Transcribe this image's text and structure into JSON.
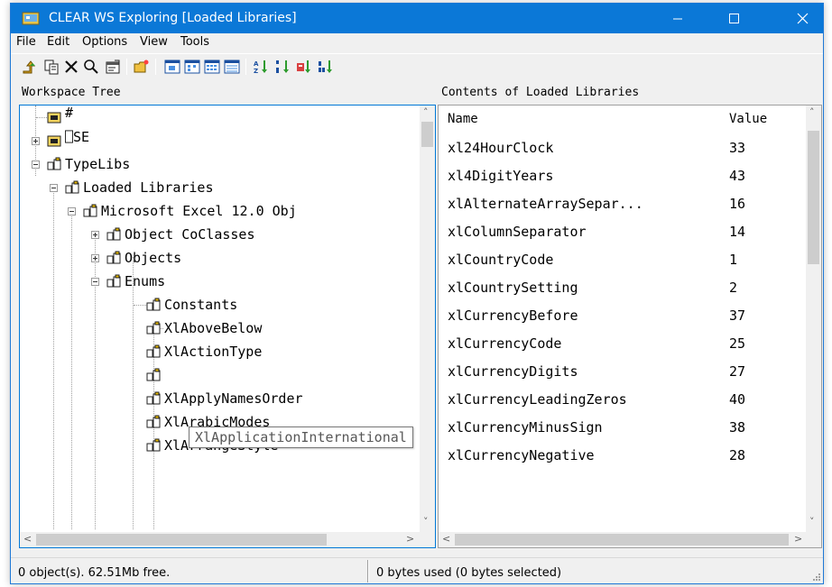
{
  "window": {
    "title": "CLEAR WS Exploring [Loaded Libraries]"
  },
  "menu": [
    "File",
    "Edit",
    "Options",
    "View",
    "Tools"
  ],
  "toolbar": {
    "buttons": [
      "up-folder-icon",
      "copy-icon",
      "delete-icon",
      "find-icon",
      "properties-icon",
      "new-folder-icon",
      "large-icons-view-icon",
      "small-icons-view-icon",
      "list-view-icon",
      "details-view-icon",
      "sort-by-name-icon",
      "sort-by-type-icon",
      "sort-by-size-icon",
      "sort-by-date-icon"
    ]
  },
  "tree": {
    "header": "Workspace Tree",
    "items": [
      {
        "label": "#"
      },
      {
        "label": "⎕SE"
      },
      {
        "label": "TypeLibs"
      },
      {
        "label": "Loaded Libraries"
      },
      {
        "label": "Microsoft Excel 12.0 Obj"
      },
      {
        "label": "Object CoClasses"
      },
      {
        "label": "Objects"
      },
      {
        "label": "Enums"
      },
      {
        "label": "Constants"
      },
      {
        "label": "XlAboveBelow"
      },
      {
        "label": "XlActionType"
      },
      {
        "label": ""
      },
      {
        "label": "XlApplyNamesOrder"
      },
      {
        "label": "XlArabicModes"
      },
      {
        "label": "XlArrangeStyle"
      }
    ],
    "tooltip": "XlApplicationInternational"
  },
  "list": {
    "header": "Contents of Loaded Libraries",
    "columns": {
      "name": "Name",
      "value": "Value"
    },
    "rows": [
      {
        "name": "xl24HourClock",
        "value": "33"
      },
      {
        "name": "xl4DigitYears",
        "value": "43"
      },
      {
        "name": "xlAlternateArraySepar...",
        "value": "16"
      },
      {
        "name": "xlColumnSeparator",
        "value": "14"
      },
      {
        "name": "xlCountryCode",
        "value": "1"
      },
      {
        "name": "xlCountrySetting",
        "value": "2"
      },
      {
        "name": "xlCurrencyBefore",
        "value": "37"
      },
      {
        "name": "xlCurrencyCode",
        "value": "25"
      },
      {
        "name": "xlCurrencyDigits",
        "value": "27"
      },
      {
        "name": "xlCurrencyLeadingZeros",
        "value": "40"
      },
      {
        "name": "xlCurrencyMinusSign",
        "value": "38"
      },
      {
        "name": "xlCurrencyNegative",
        "value": "28"
      }
    ]
  },
  "status": {
    "objects": "0 object(s). 62.51Mb free.",
    "bytes": "0 bytes used (0 bytes selected)"
  },
  "colors": {
    "titlebar": "#0b78d7",
    "focus_border": "#0078d7"
  }
}
